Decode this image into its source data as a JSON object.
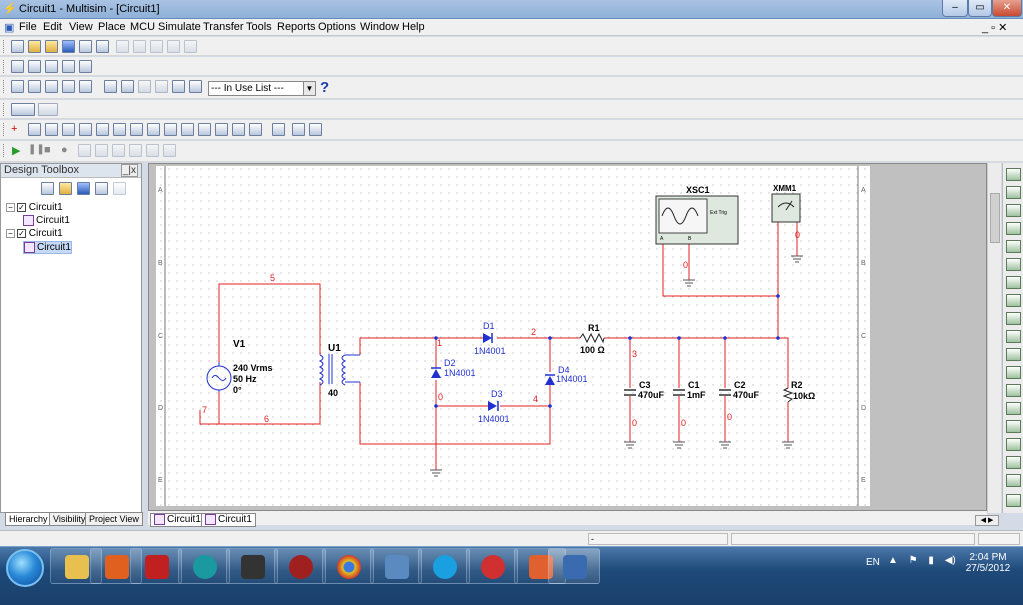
{
  "window": {
    "title": "Circuit1 - Multisim - [Circuit1]",
    "min": "–",
    "max": "▭",
    "close": "✕",
    "mdi_controls": "_ ▫ ✕"
  },
  "menu": [
    "File",
    "Edit",
    "View",
    "Place",
    "MCU",
    "Simulate",
    "Transfer",
    "Tools",
    "Reports",
    "Options",
    "Window",
    "Help"
  ],
  "toolbar": {
    "in_use_list": "--- In Use List ---",
    "help": "?"
  },
  "design_toolbox": {
    "title": "Design Toolbox",
    "close": "_|x",
    "tree": [
      {
        "label": "Circuit1",
        "level": 0,
        "toggle": "−",
        "checked": true
      },
      {
        "label": "Circuit1",
        "level": 1
      },
      {
        "label": "Circuit1",
        "level": 0,
        "toggle": "−",
        "checked": true
      },
      {
        "label": "Circuit1",
        "level": 1,
        "selected": true
      }
    ],
    "tabs": [
      "Hierarchy",
      "Visibility",
      "Project View"
    ]
  },
  "sheet_tabs": [
    "Circuit1",
    "Circuit1"
  ],
  "border_rows": [
    "A",
    "B",
    "C",
    "D",
    "E"
  ],
  "circuit": {
    "V1": {
      "name": "V1",
      "rating": "240 Vrms",
      "freq": "50 Hz",
      "phase": "0°"
    },
    "U1": {
      "name": "U1",
      "ratio": "40"
    },
    "D1": {
      "name": "D1",
      "part": "1N4001"
    },
    "D2": {
      "name": "D2",
      "part": "1N4001"
    },
    "D3": {
      "name": "D3",
      "part": "1N4001"
    },
    "D4": {
      "name": "D4",
      "part": "1N4001"
    },
    "R1": {
      "name": "R1",
      "value": "100 Ω"
    },
    "R2": {
      "name": "R2",
      "value": "10kΩ"
    },
    "C3": {
      "name": "C3",
      "value": "470uF"
    },
    "C1": {
      "name": "C1",
      "value": "1mF"
    },
    "C2": {
      "name": "C2",
      "value": "470uF"
    },
    "XSC1": {
      "name": "XSC1",
      "ext_trig": "Ext Trig",
      "a": "A",
      "b": "B"
    },
    "XMM1": {
      "name": "XMM1"
    },
    "nets": {
      "n5": "5",
      "n6": "6",
      "n7": "7",
      "n1": "1",
      "n2": "2",
      "n3": "3",
      "n4": "4",
      "n0a": "0",
      "n0b": "0",
      "n0c": "0",
      "n0d": "0",
      "n0e": "0",
      "n0f": "0"
    }
  },
  "taskbar": {
    "lang": "EN",
    "time": "2:04 PM",
    "date": "27/5/2012"
  },
  "colors": {
    "wire": "#e02020",
    "component": "#2030d0",
    "netlabel": "#e02020",
    "grid_dot": "#b0b0b0"
  }
}
